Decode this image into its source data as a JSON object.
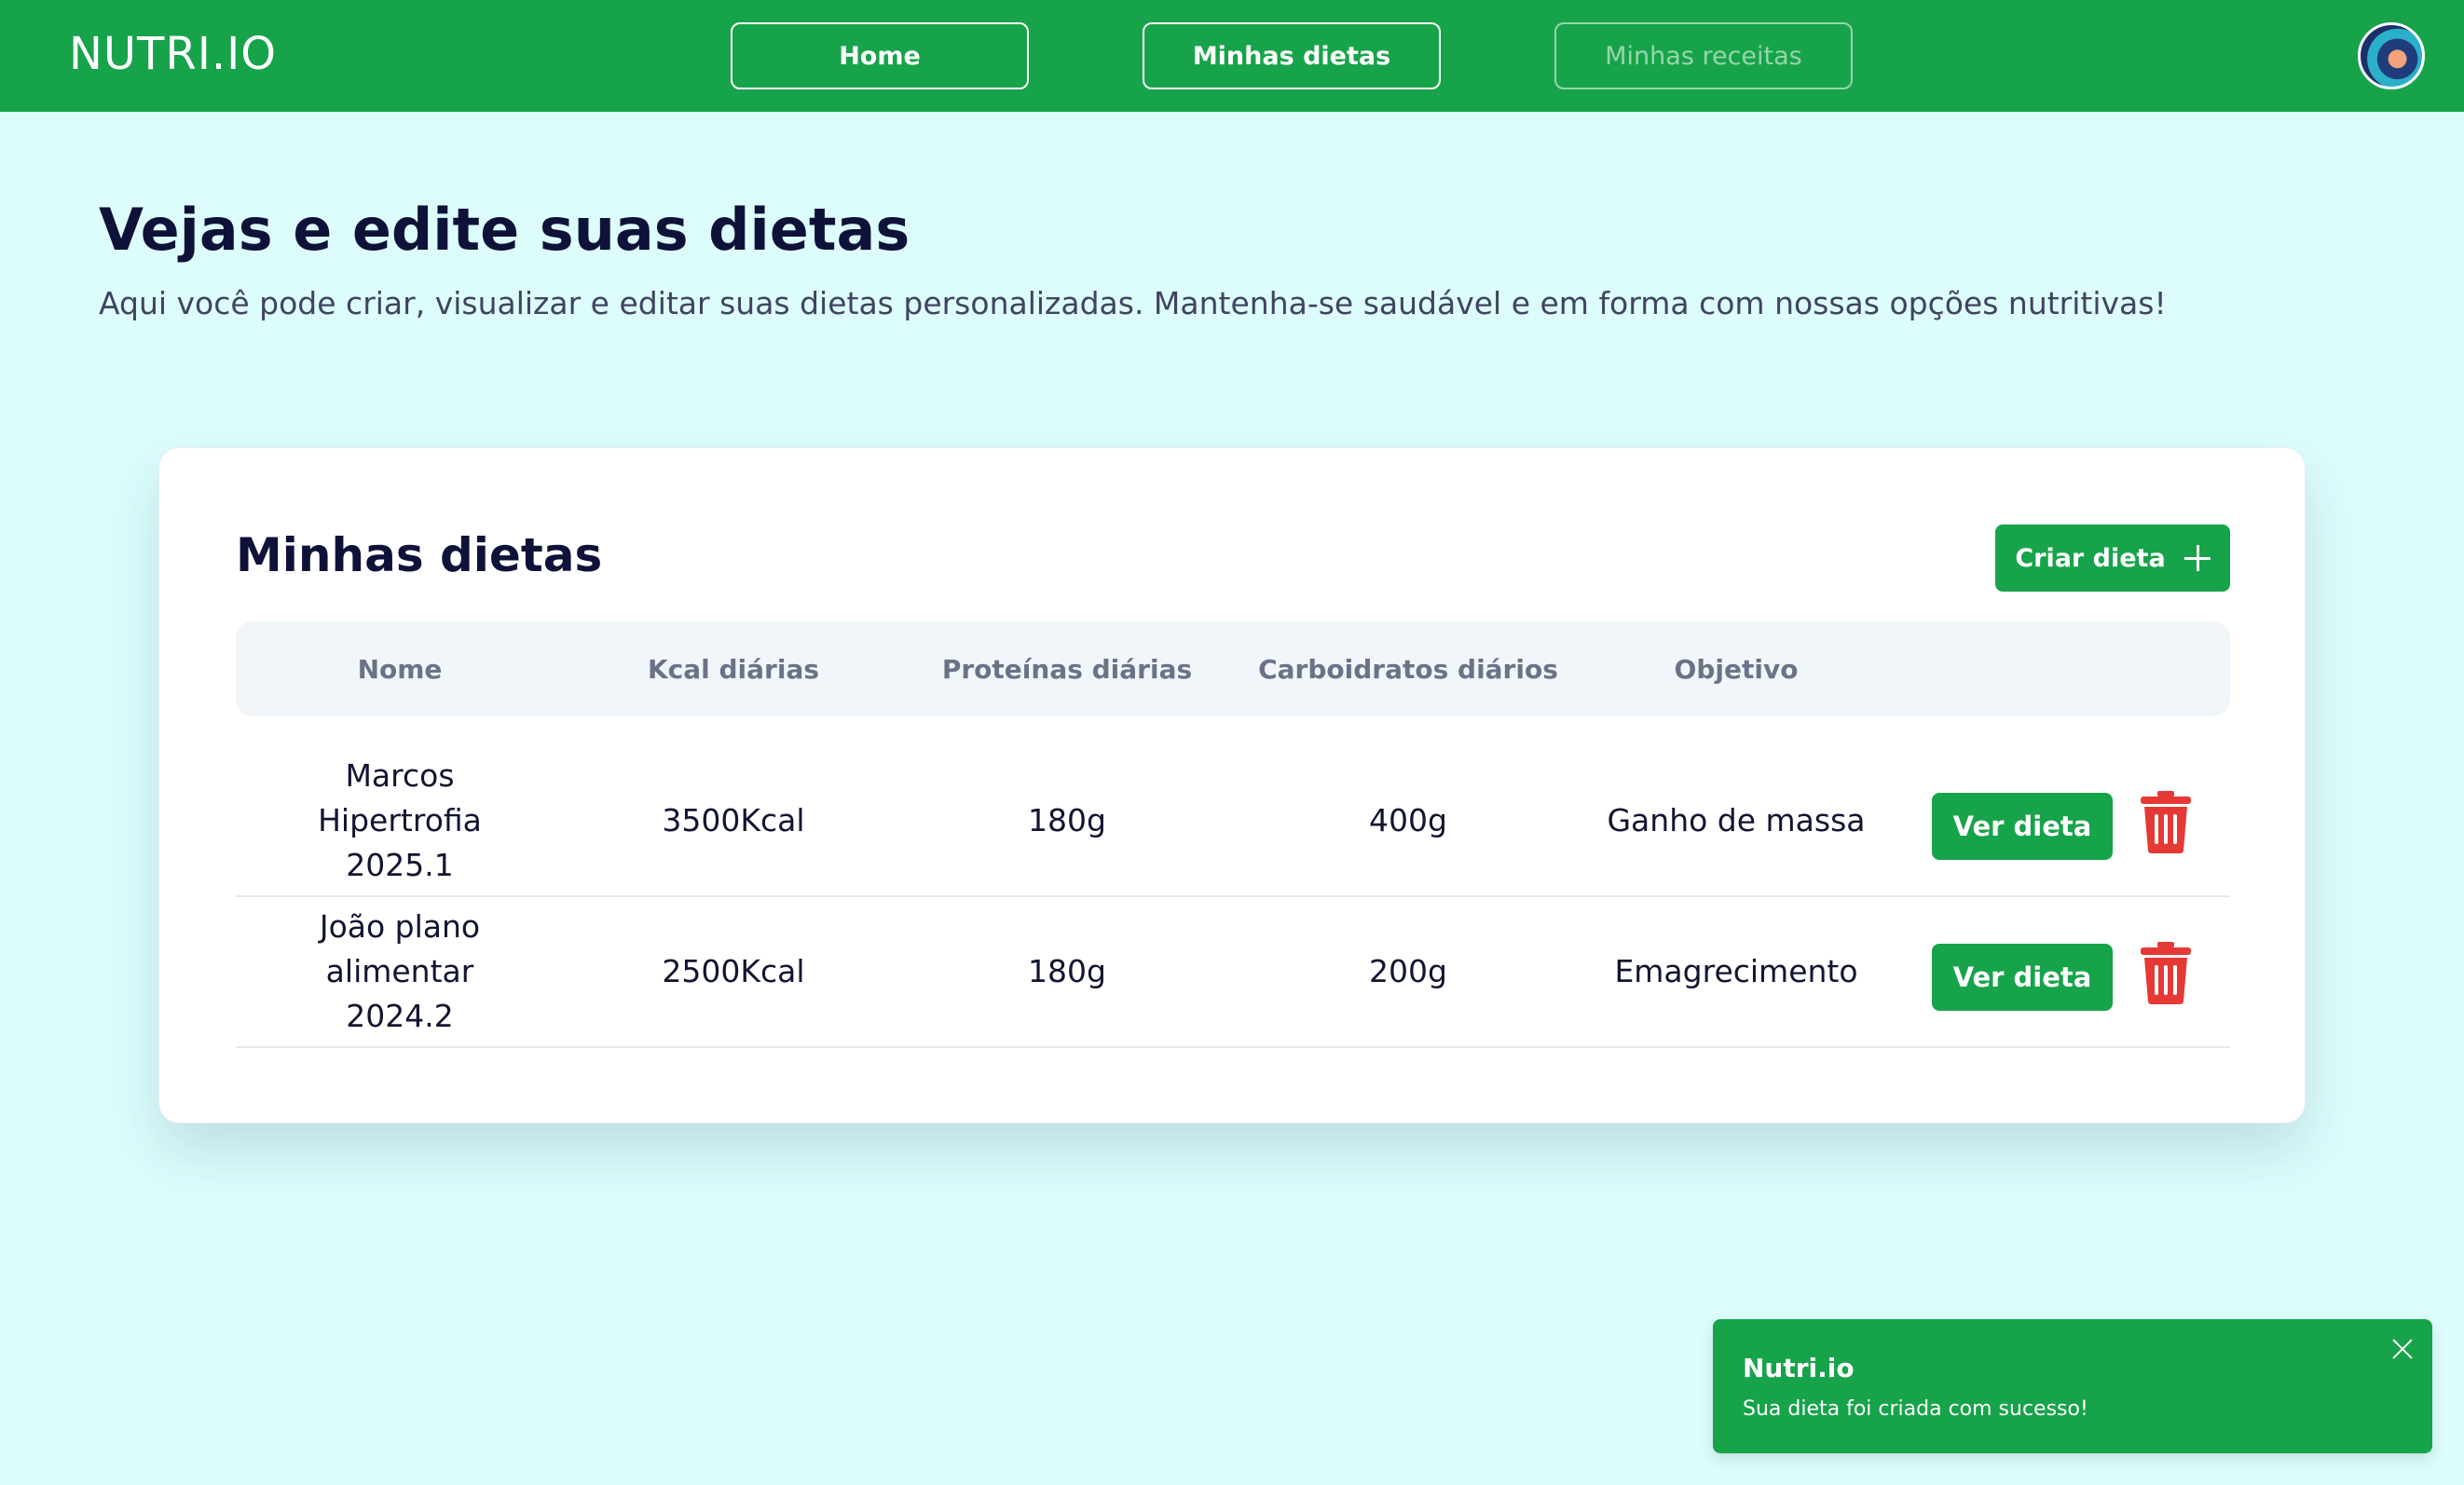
{
  "header": {
    "brand": "NUTRI.IO",
    "nav": [
      {
        "label": "Home"
      },
      {
        "label": "Minhas dietas"
      },
      {
        "label": "Minhas receitas"
      }
    ]
  },
  "page": {
    "title": "Vejas e edite suas dietas",
    "subtitle": "Aqui você pode criar, visualizar e editar suas dietas personalizadas. Mantenha-se saudável e em forma com nossas opções nutritivas!"
  },
  "card": {
    "title": "Minhas dietas",
    "create_label": "Criar dieta",
    "columns": [
      "Nome",
      "Kcal diárias",
      "Proteínas diárias",
      "Carboidratos diários",
      "Objetivo"
    ],
    "rows": [
      {
        "name": "Marcos Hipertrofia 2025.1",
        "kcal": "3500Kcal",
        "protein": "180g",
        "carbs": "400g",
        "goal": "Ganho de massa",
        "view_label": "Ver dieta"
      },
      {
        "name": "João plano alimentar 2024.2",
        "kcal": "2500Kcal",
        "protein": "180g",
        "carbs": "200g",
        "goal": "Emagrecimento",
        "view_label": "Ver dieta"
      }
    ]
  },
  "toast": {
    "title": "Nutri.io",
    "message": "Sua dieta foi criada com sucesso!"
  },
  "colors": {
    "primary": "#17a34a",
    "background": "#ddfdfd",
    "danger": "#e53935"
  }
}
